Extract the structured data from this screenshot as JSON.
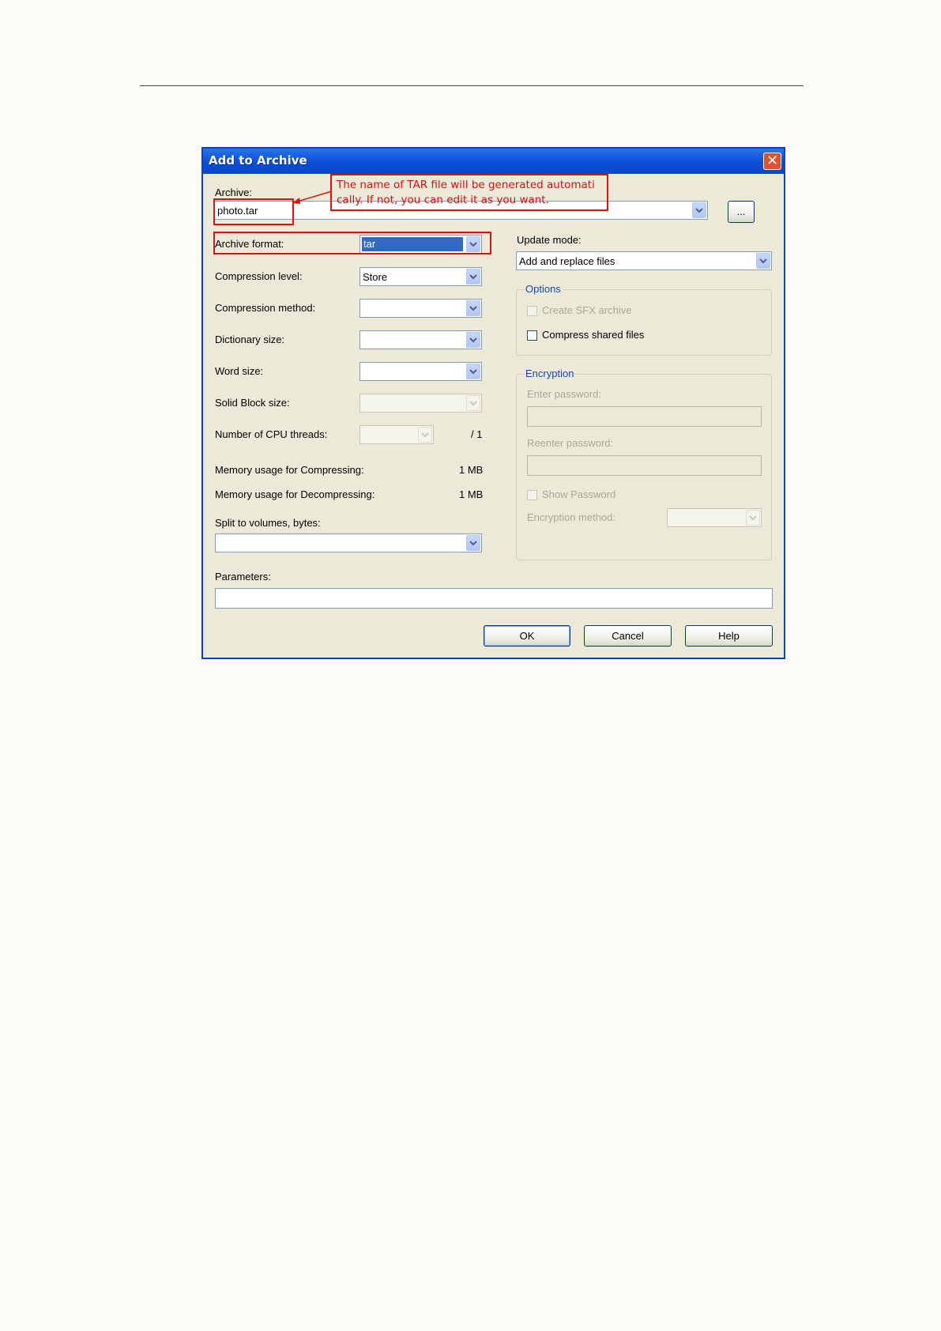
{
  "window": {
    "title": "Add to Archive",
    "close_glyph": "✕"
  },
  "archive": {
    "label": "Archive:",
    "value": "photo.tar",
    "browse_label": "..."
  },
  "annotation": {
    "line1": "The name of TAR file will be generated automati",
    "line2": "cally. If not, you can edit it as you want."
  },
  "left": {
    "archive_format": {
      "label": "Archive format:",
      "value": "tar"
    },
    "compression_level": {
      "label": "Compression level:",
      "value": "Store"
    },
    "compression_method": {
      "label": "Compression method:",
      "value": ""
    },
    "dictionary_size": {
      "label": "Dictionary size:",
      "value": ""
    },
    "word_size": {
      "label": "Word size:",
      "value": ""
    },
    "solid_block_size": {
      "label": "Solid Block size:",
      "value": ""
    },
    "cpu_threads": {
      "label": "Number of CPU threads:",
      "value": "",
      "suffix": "/ 1"
    },
    "mem_compress": {
      "label": "Memory usage for Compressing:",
      "value": "1 MB"
    },
    "mem_decompress": {
      "label": "Memory usage for Decompressing:",
      "value": "1 MB"
    },
    "split": {
      "label": "Split to volumes, bytes:",
      "value": ""
    }
  },
  "right": {
    "update_mode": {
      "label": "Update mode:",
      "value": "Add and replace files"
    },
    "options": {
      "title": "Options",
      "sfx": "Create SFX archive",
      "shared": "Compress shared files"
    },
    "encryption": {
      "title": "Encryption",
      "enter_password": "Enter password:",
      "reenter_password": "Reenter password:",
      "show_password": "Show Password",
      "method": "Encryption method:"
    }
  },
  "parameters": {
    "label": "Parameters:",
    "value": ""
  },
  "buttons": {
    "ok": "OK",
    "cancel": "Cancel",
    "help": "Help"
  },
  "colors": {
    "annotation": "#e01010",
    "titlebar": "#0b4fd8",
    "dialog_bg": "#ece9d8"
  },
  "icons": {
    "close": "close-icon",
    "dropdown": "chevron-down-icon",
    "arrow": "arrow-left-icon"
  }
}
